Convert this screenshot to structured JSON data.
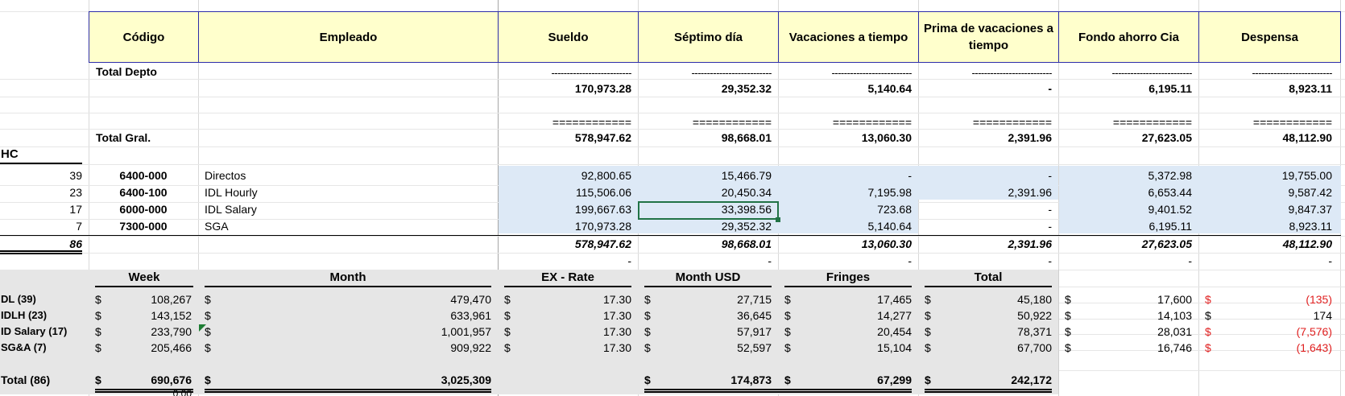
{
  "headers": [
    "Código",
    "Empleado",
    "Sueldo",
    "Séptimo día",
    "Vacaciones a tiempo",
    "Prima de vacaciones a tiempo",
    "Fondo ahorro Cia",
    "Despensa"
  ],
  "total_depto": {
    "label": "Total Depto",
    "dashes": "--------------------------",
    "values": [
      "170,973.28",
      "29,352.32",
      "5,140.64",
      "-",
      "6,195.11",
      "8,923.11"
    ]
  },
  "total_gral": {
    "label": "Total Gral.",
    "equals": "============",
    "values": [
      "578,947.62",
      "98,668.01",
      "13,060.30",
      "2,391.96",
      "27,623.05",
      "48,112.90"
    ]
  },
  "hc_label": "HC",
  "dept_rows": [
    {
      "hc": "39",
      "code": "6400-000",
      "name": "Directos",
      "values": [
        "92,800.65",
        "15,466.79",
        "-",
        "-",
        "5,372.98",
        "19,755.00"
      ]
    },
    {
      "hc": "23",
      "code": "6400-100",
      "name": "IDL Hourly",
      "values": [
        "115,506.06",
        "20,450.34",
        "7,195.98",
        "2,391.96",
        "6,653.44",
        "9,587.42"
      ]
    },
    {
      "hc": "17",
      "code": "6000-000",
      "name": "IDL Salary",
      "values": [
        "199,667.63",
        "33,398.56",
        "723.68",
        "-",
        "9,401.52",
        "9,847.37"
      ]
    },
    {
      "hc": "7",
      "code": "7300-000",
      "name": "SGA",
      "values": [
        "170,973.28",
        "29,352.32",
        "5,140.64",
        "-",
        "6,195.11",
        "8,923.11"
      ]
    }
  ],
  "dept_total": {
    "hc": "86",
    "values": [
      "578,947.62",
      "98,668.01",
      "13,060.30",
      "2,391.96",
      "27,623.05",
      "48,112.90"
    ]
  },
  "check_dashes": [
    "-",
    "-",
    "-",
    "-",
    "-",
    "-"
  ],
  "summary": {
    "headers": [
      "Week",
      "Month",
      "EX - Rate",
      "Month USD",
      "Fringes",
      "Total"
    ],
    "currency": "$",
    "rows": [
      {
        "label": "DL (39)",
        "week": "108,267",
        "month": "479,470",
        "rate": "17.30",
        "usd": "27,715",
        "fringes": "17,465",
        "total": "45,180",
        "extra": "17,600",
        "diff": "(135)",
        "diff_red": true
      },
      {
        "label": "IDLH (23)",
        "week": "143,152",
        "month": "633,961",
        "rate": "17.30",
        "usd": "36,645",
        "fringes": "14,277",
        "total": "50,922",
        "extra": "14,103",
        "diff": "174",
        "diff_red": false
      },
      {
        "label": "ID Salary (17)",
        "week": "233,790",
        "month": "1,001,957",
        "rate": "17.30",
        "usd": "57,917",
        "fringes": "20,454",
        "total": "78,371",
        "extra": "28,031",
        "diff": "(7,576)",
        "diff_red": true
      },
      {
        "label": "SG&A (7)",
        "week": "205,466",
        "month": "909,922",
        "rate": "17.30",
        "usd": "52,597",
        "fringes": "15,104",
        "total": "67,700",
        "extra": "16,746",
        "diff": "(1,643)",
        "diff_red": true
      }
    ],
    "total": {
      "label": "Total (86)",
      "week": "690,676",
      "month": "3,025,309",
      "usd": "174,873",
      "fringes": "67,299",
      "total": "242,172"
    },
    "bottom_partial": "0.00"
  },
  "colors": {
    "header_fill": "#ffffcc",
    "header_border": "#2c2ca8",
    "blue_fill": "#dde9f6",
    "gray_fill": "#e6e6e6",
    "negative": "#e02020",
    "selection": "#217346"
  }
}
